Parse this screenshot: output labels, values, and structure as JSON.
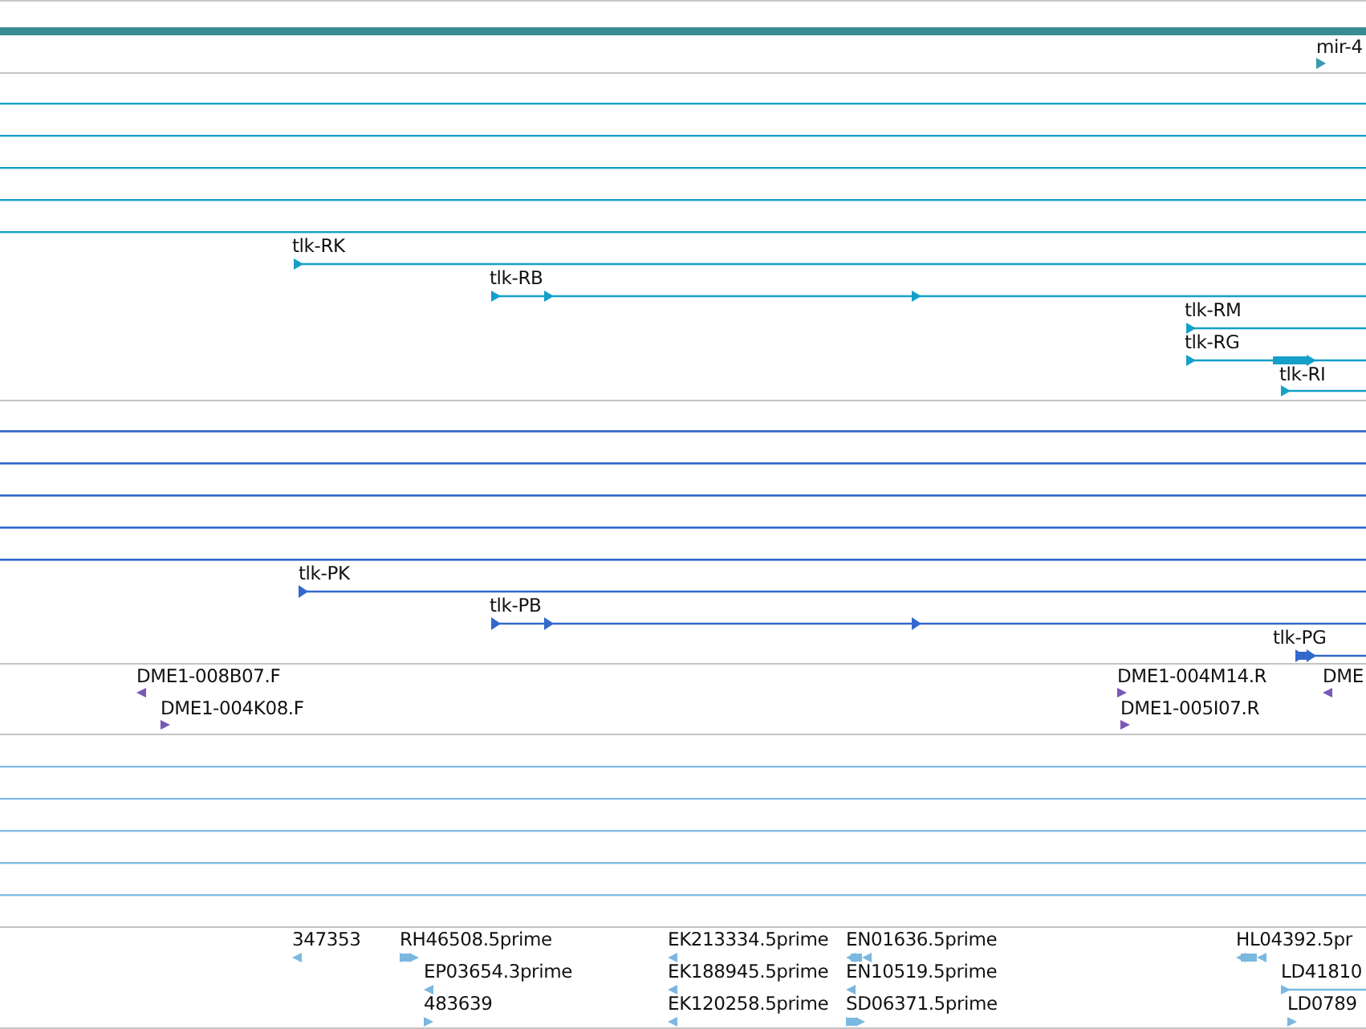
{
  "tracks": [
    {
      "kind": "mirna",
      "color": "#3a9ab0",
      "features": [
        {
          "label": "mir-4",
          "reverse": false
        }
      ]
    },
    {
      "kind": "transcript",
      "color": "#14a0c8",
      "features": [
        {
          "label": "tlk-RK",
          "reverse": false
        },
        {
          "label": "tlk-RB",
          "reverse": false
        },
        {
          "label": "tlk-RM",
          "reverse": false
        },
        {
          "label": "tlk-RG",
          "reverse": false
        },
        {
          "label": "tlk-RI",
          "reverse": false
        }
      ]
    },
    {
      "kind": "protein",
      "color": "#3368cc",
      "features": [
        {
          "label": "tlk-PK",
          "reverse": false
        },
        {
          "label": "tlk-PB",
          "reverse": false
        },
        {
          "label": "tlk-PG",
          "reverse": false
        }
      ]
    },
    {
      "kind": "read",
      "color": "#7a58b8",
      "features": [
        {
          "label": "DME1-008B07.F",
          "reverse": true
        },
        {
          "label": "DME1-004K08.F",
          "reverse": false
        },
        {
          "label": "DME1-004M14.R",
          "reverse": false
        },
        {
          "label": "DME1-005I07.R",
          "reverse": false
        },
        {
          "label": "DME",
          "reverse": true
        }
      ]
    },
    {
      "kind": "transcript",
      "color": "#80bce4"
    },
    {
      "kind": "read",
      "color": "#7ab8e0",
      "features": [
        {
          "label": "347353",
          "reverse": true
        },
        {
          "label": "RH46508.5prime",
          "reverse": false
        },
        {
          "label": "EP03654.3prime",
          "reverse": true
        },
        {
          "label": "483639",
          "reverse": false
        },
        {
          "label": "EK213334.5prime",
          "reverse": true
        },
        {
          "label": "EK188945.5prime",
          "reverse": true
        },
        {
          "label": "EK120258.5prime",
          "reverse": true
        },
        {
          "label": "EN01636.5prime",
          "reverse": true
        },
        {
          "label": "EN10519.5prime",
          "reverse": true
        },
        {
          "label": "SD06371.5prime",
          "reverse": false
        },
        {
          "label": "HL04392.5pr",
          "reverse": true
        },
        {
          "label": "LD41810",
          "reverse": false
        },
        {
          "label": "LD0789",
          "reverse": false
        }
      ]
    }
  ]
}
